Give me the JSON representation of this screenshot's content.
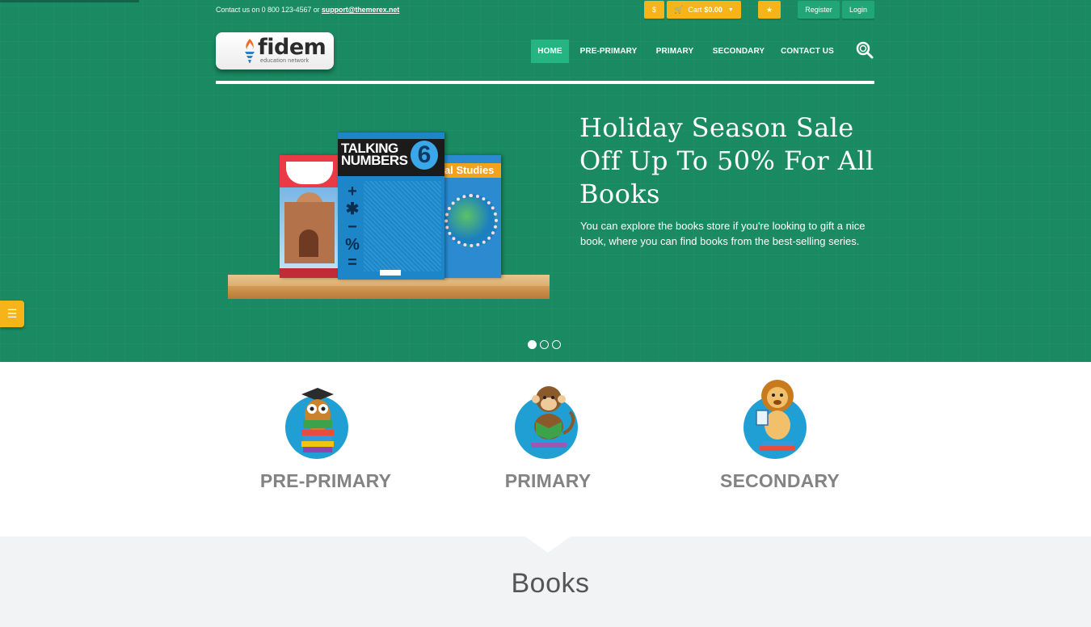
{
  "topbar": {
    "contact_prefix": "Contact us on 0 800 123-4567 or",
    "contact_email": "support@themerex.net",
    "currency_label": "$",
    "cart_label": "Cart",
    "cart_amount": "$0.00",
    "register_label": "Register",
    "login_label": "Login"
  },
  "logo": {
    "name": "fidem",
    "tagline": "education network"
  },
  "nav": {
    "items": [
      "HOME",
      "PRE-PRIMARY",
      "PRIMARY",
      "SECONDARY",
      "CONTACT US"
    ],
    "active": "HOME"
  },
  "hero": {
    "headline_lines": [
      "Holiday Season Sale",
      "Off Up To 50% For All",
      "Books"
    ],
    "description": "You can explore the books store if you're looking to gift a nice book, where you can find books from the best-selling series.",
    "slides": {
      "count": 3,
      "active": 1
    },
    "book_cover_texts": {
      "talking_numbers_line1": "TALKING",
      "talking_numbers_line2": "NUMBERS",
      "talking_numbers_number": "6",
      "social_studies": "al Studies"
    }
  },
  "categories": [
    {
      "label": "PRE-PRIMARY",
      "icon": "owl-reading-icon"
    },
    {
      "label": "PRIMARY",
      "icon": "monkey-reading-icon"
    },
    {
      "label": "SECONDARY",
      "icon": "lion-reading-icon"
    }
  ],
  "books_section": {
    "title": "Books"
  },
  "colors": {
    "hero_green": "#1a8a63",
    "accent_yellow": "#f5b41a",
    "nav_active": "#25b583",
    "category_blue": "#1f9fd3"
  }
}
